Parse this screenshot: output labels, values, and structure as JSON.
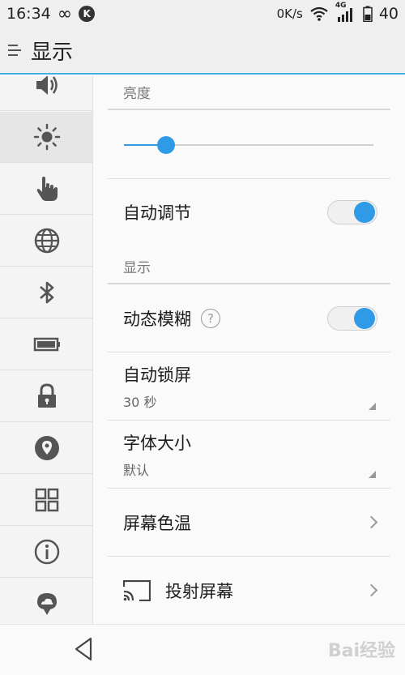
{
  "status_bar": {
    "time": "16:34",
    "infinity_glyph": "∞",
    "k_badge": "K",
    "net_speed": "0K/s",
    "network_type": "4G",
    "battery": "40"
  },
  "header": {
    "title": "显示"
  },
  "sidebar": {
    "items": [
      {
        "icon": "volume-icon"
      },
      {
        "icon": "brightness-icon",
        "active": true
      },
      {
        "icon": "touch-hand-icon"
      },
      {
        "icon": "globe-icon"
      },
      {
        "icon": "bluetooth-icon"
      },
      {
        "icon": "battery-icon"
      },
      {
        "icon": "lock-icon"
      },
      {
        "icon": "location-pin-icon"
      },
      {
        "icon": "apps-grid-icon"
      },
      {
        "icon": "info-icon"
      },
      {
        "icon": "cloud-icon"
      }
    ]
  },
  "brightness_section": {
    "header": "亮度",
    "slider_level": 0.17,
    "auto_adjust": {
      "label": "自动调节",
      "enabled": true
    }
  },
  "display_section": {
    "header": "显示",
    "dynamic_blur": {
      "label": "动态模糊",
      "help_glyph": "?",
      "enabled": true
    },
    "auto_lock": {
      "label": "自动锁屏",
      "value": "30 秒"
    },
    "font_size": {
      "label": "字体大小",
      "value": "默认"
    },
    "color_temp": {
      "label": "屏幕色温"
    },
    "screen_cast": {
      "label": "投射屏幕"
    }
  },
  "colors": {
    "accent": "#2f9be6",
    "header_line": "#40b4e8"
  },
  "watermark": "Bai经验"
}
